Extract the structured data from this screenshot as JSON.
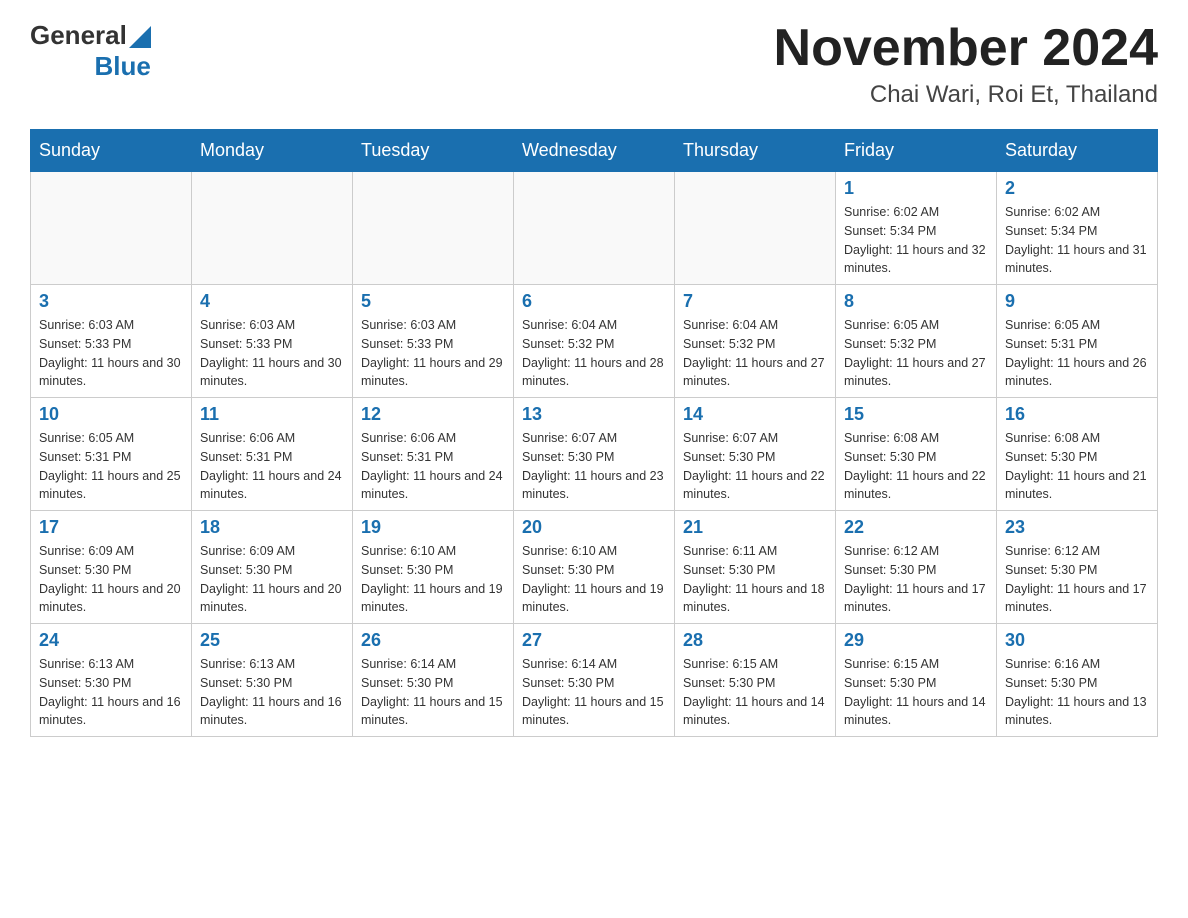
{
  "header": {
    "logo_general": "General",
    "logo_blue": "Blue",
    "month_title": "November 2024",
    "location": "Chai Wari, Roi Et, Thailand"
  },
  "days_of_week": [
    "Sunday",
    "Monday",
    "Tuesday",
    "Wednesday",
    "Thursday",
    "Friday",
    "Saturday"
  ],
  "weeks": [
    [
      {
        "day": "",
        "sunrise": "",
        "sunset": "",
        "daylight": ""
      },
      {
        "day": "",
        "sunrise": "",
        "sunset": "",
        "daylight": ""
      },
      {
        "day": "",
        "sunrise": "",
        "sunset": "",
        "daylight": ""
      },
      {
        "day": "",
        "sunrise": "",
        "sunset": "",
        "daylight": ""
      },
      {
        "day": "",
        "sunrise": "",
        "sunset": "",
        "daylight": ""
      },
      {
        "day": "1",
        "sunrise": "Sunrise: 6:02 AM",
        "sunset": "Sunset: 5:34 PM",
        "daylight": "Daylight: 11 hours and 32 minutes."
      },
      {
        "day": "2",
        "sunrise": "Sunrise: 6:02 AM",
        "sunset": "Sunset: 5:34 PM",
        "daylight": "Daylight: 11 hours and 31 minutes."
      }
    ],
    [
      {
        "day": "3",
        "sunrise": "Sunrise: 6:03 AM",
        "sunset": "Sunset: 5:33 PM",
        "daylight": "Daylight: 11 hours and 30 minutes."
      },
      {
        "day": "4",
        "sunrise": "Sunrise: 6:03 AM",
        "sunset": "Sunset: 5:33 PM",
        "daylight": "Daylight: 11 hours and 30 minutes."
      },
      {
        "day": "5",
        "sunrise": "Sunrise: 6:03 AM",
        "sunset": "Sunset: 5:33 PM",
        "daylight": "Daylight: 11 hours and 29 minutes."
      },
      {
        "day": "6",
        "sunrise": "Sunrise: 6:04 AM",
        "sunset": "Sunset: 5:32 PM",
        "daylight": "Daylight: 11 hours and 28 minutes."
      },
      {
        "day": "7",
        "sunrise": "Sunrise: 6:04 AM",
        "sunset": "Sunset: 5:32 PM",
        "daylight": "Daylight: 11 hours and 27 minutes."
      },
      {
        "day": "8",
        "sunrise": "Sunrise: 6:05 AM",
        "sunset": "Sunset: 5:32 PM",
        "daylight": "Daylight: 11 hours and 27 minutes."
      },
      {
        "day": "9",
        "sunrise": "Sunrise: 6:05 AM",
        "sunset": "Sunset: 5:31 PM",
        "daylight": "Daylight: 11 hours and 26 minutes."
      }
    ],
    [
      {
        "day": "10",
        "sunrise": "Sunrise: 6:05 AM",
        "sunset": "Sunset: 5:31 PM",
        "daylight": "Daylight: 11 hours and 25 minutes."
      },
      {
        "day": "11",
        "sunrise": "Sunrise: 6:06 AM",
        "sunset": "Sunset: 5:31 PM",
        "daylight": "Daylight: 11 hours and 24 minutes."
      },
      {
        "day": "12",
        "sunrise": "Sunrise: 6:06 AM",
        "sunset": "Sunset: 5:31 PM",
        "daylight": "Daylight: 11 hours and 24 minutes."
      },
      {
        "day": "13",
        "sunrise": "Sunrise: 6:07 AM",
        "sunset": "Sunset: 5:30 PM",
        "daylight": "Daylight: 11 hours and 23 minutes."
      },
      {
        "day": "14",
        "sunrise": "Sunrise: 6:07 AM",
        "sunset": "Sunset: 5:30 PM",
        "daylight": "Daylight: 11 hours and 22 minutes."
      },
      {
        "day": "15",
        "sunrise": "Sunrise: 6:08 AM",
        "sunset": "Sunset: 5:30 PM",
        "daylight": "Daylight: 11 hours and 22 minutes."
      },
      {
        "day": "16",
        "sunrise": "Sunrise: 6:08 AM",
        "sunset": "Sunset: 5:30 PM",
        "daylight": "Daylight: 11 hours and 21 minutes."
      }
    ],
    [
      {
        "day": "17",
        "sunrise": "Sunrise: 6:09 AM",
        "sunset": "Sunset: 5:30 PM",
        "daylight": "Daylight: 11 hours and 20 minutes."
      },
      {
        "day": "18",
        "sunrise": "Sunrise: 6:09 AM",
        "sunset": "Sunset: 5:30 PM",
        "daylight": "Daylight: 11 hours and 20 minutes."
      },
      {
        "day": "19",
        "sunrise": "Sunrise: 6:10 AM",
        "sunset": "Sunset: 5:30 PM",
        "daylight": "Daylight: 11 hours and 19 minutes."
      },
      {
        "day": "20",
        "sunrise": "Sunrise: 6:10 AM",
        "sunset": "Sunset: 5:30 PM",
        "daylight": "Daylight: 11 hours and 19 minutes."
      },
      {
        "day": "21",
        "sunrise": "Sunrise: 6:11 AM",
        "sunset": "Sunset: 5:30 PM",
        "daylight": "Daylight: 11 hours and 18 minutes."
      },
      {
        "day": "22",
        "sunrise": "Sunrise: 6:12 AM",
        "sunset": "Sunset: 5:30 PM",
        "daylight": "Daylight: 11 hours and 17 minutes."
      },
      {
        "day": "23",
        "sunrise": "Sunrise: 6:12 AM",
        "sunset": "Sunset: 5:30 PM",
        "daylight": "Daylight: 11 hours and 17 minutes."
      }
    ],
    [
      {
        "day": "24",
        "sunrise": "Sunrise: 6:13 AM",
        "sunset": "Sunset: 5:30 PM",
        "daylight": "Daylight: 11 hours and 16 minutes."
      },
      {
        "day": "25",
        "sunrise": "Sunrise: 6:13 AM",
        "sunset": "Sunset: 5:30 PM",
        "daylight": "Daylight: 11 hours and 16 minutes."
      },
      {
        "day": "26",
        "sunrise": "Sunrise: 6:14 AM",
        "sunset": "Sunset: 5:30 PM",
        "daylight": "Daylight: 11 hours and 15 minutes."
      },
      {
        "day": "27",
        "sunrise": "Sunrise: 6:14 AM",
        "sunset": "Sunset: 5:30 PM",
        "daylight": "Daylight: 11 hours and 15 minutes."
      },
      {
        "day": "28",
        "sunrise": "Sunrise: 6:15 AM",
        "sunset": "Sunset: 5:30 PM",
        "daylight": "Daylight: 11 hours and 14 minutes."
      },
      {
        "day": "29",
        "sunrise": "Sunrise: 6:15 AM",
        "sunset": "Sunset: 5:30 PM",
        "daylight": "Daylight: 11 hours and 14 minutes."
      },
      {
        "day": "30",
        "sunrise": "Sunrise: 6:16 AM",
        "sunset": "Sunset: 5:30 PM",
        "daylight": "Daylight: 11 hours and 13 minutes."
      }
    ]
  ]
}
